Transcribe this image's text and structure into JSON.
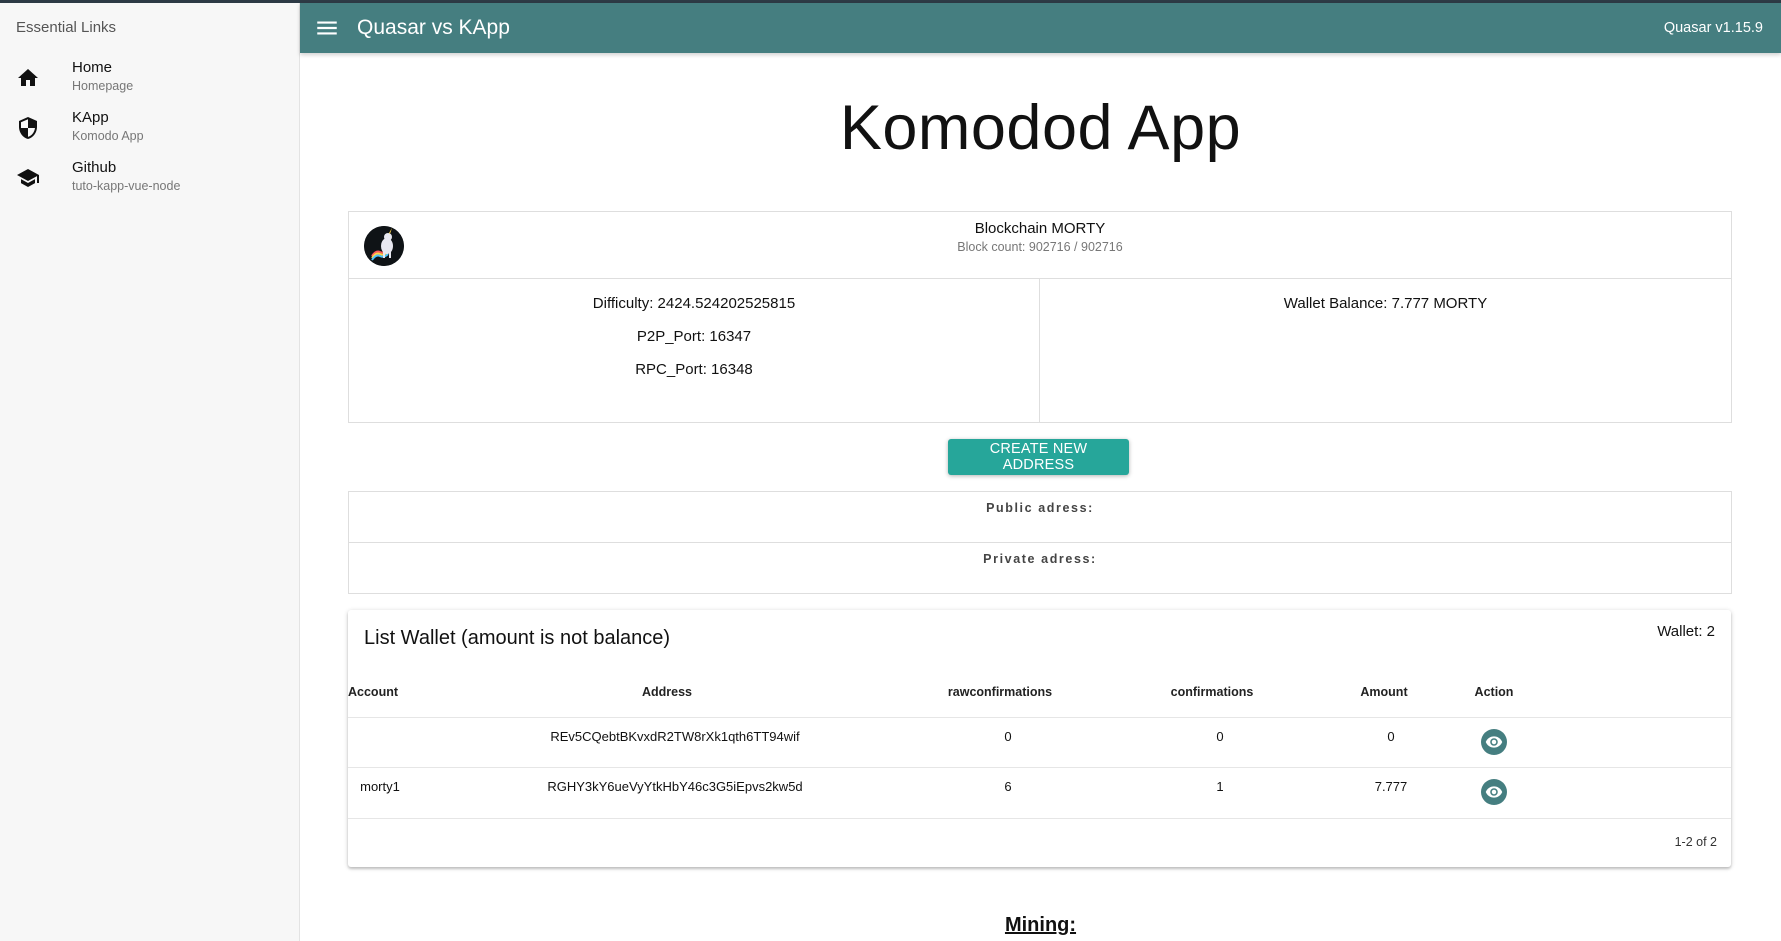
{
  "sidebar": {
    "header": "Essential Links",
    "items": [
      {
        "label": "Home",
        "caption": "Homepage",
        "icon": "home-icon"
      },
      {
        "label": "KApp",
        "caption": "Komodo App",
        "icon": "shield-icon"
      },
      {
        "label": "Github",
        "caption": "tuto-kapp-vue-node",
        "icon": "school-icon"
      }
    ]
  },
  "header": {
    "title": "Quasar vs KApp",
    "version": "Quasar v1.15.9"
  },
  "main": {
    "page_title": "Komodod App",
    "blockchain": {
      "name": "Blockchain MORTY",
      "block_count": "Block count: 902716 / 902716",
      "difficulty": "Difficulty: 2424.524202525815",
      "p2p_port": "P2P_Port: 16347",
      "rpc_port": "RPC_Port: 16348",
      "wallet_balance": "Wallet Balance: 7.777 MORTY"
    },
    "create_button": "CREATE NEW ADDRESS",
    "public_address_label": "Public adress:",
    "private_address_label": "Private adress:",
    "wallet": {
      "title": "List Wallet (amount is not balance)",
      "count": "Wallet: 2",
      "columns": [
        "Account",
        "Address",
        "rawconfirmations",
        "confirmations",
        "Amount",
        "Action"
      ],
      "rows": [
        {
          "account": "",
          "address": "REv5CQebtBKvxdR2TW8rXk1qth6TT94wif",
          "rawconfirmations": "0",
          "confirmations": "0",
          "amount": "0"
        },
        {
          "account": "morty1",
          "address": "RGHY3kY6ueVyYtkHbY46c3G5iEpvs2kw5d",
          "rawconfirmations": "6",
          "confirmations": "1",
          "amount": "7.777"
        }
      ],
      "pagination": "1-2 of 2"
    },
    "mining_heading": "Mining:"
  },
  "colors": {
    "header_bg": "#457e80",
    "button_bg": "#26a69a",
    "sidebar_bg": "#f7f7f7"
  }
}
